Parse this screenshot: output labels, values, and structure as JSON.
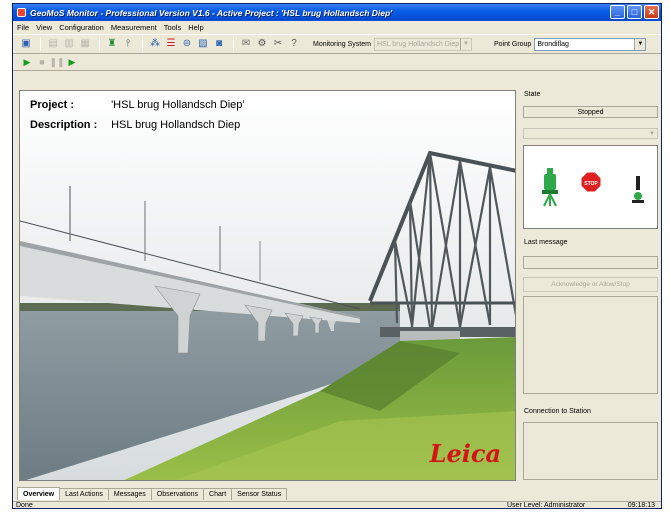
{
  "window": {
    "title": "GeoMoS Monitor - Professional Version V1.6 - Active Project : 'HSL brug Hollandsch Diep'",
    "colors": {
      "titlebar": "#0a5ce5",
      "close": "#c83a17",
      "face": "#ece9d8"
    }
  },
  "menu": [
    "File",
    "View",
    "Configuration",
    "Measurement",
    "Tools",
    "Help"
  ],
  "toolbar": {
    "monitoring_label": "Monitoring System",
    "monitoring_value": "HSL brug Hollandsch Diep",
    "point_group_label": "Point Group",
    "point_group_value": "Brondiflag"
  },
  "project": {
    "project_label": "Project :",
    "project_value": "'HSL brug Hollandsch Diep'",
    "description_label": "Description :",
    "description_value": "HSL brug Hollandsch Diep",
    "logo_text": "Leica"
  },
  "side": {
    "state_label": "State",
    "state_value": "Stopped",
    "last_message_label": "Last message",
    "ack_button": "Acknowledge or Allow/Stop",
    "connection_label": "Connection to Station",
    "stop_text": "STOP"
  },
  "tabs": [
    "Overview",
    "Last Actions",
    "Messages",
    "Observations",
    "Chart",
    "Sensor Status"
  ],
  "status": {
    "left": "Done",
    "user_level": "User Level: Administrator",
    "time": "09:18:13"
  }
}
